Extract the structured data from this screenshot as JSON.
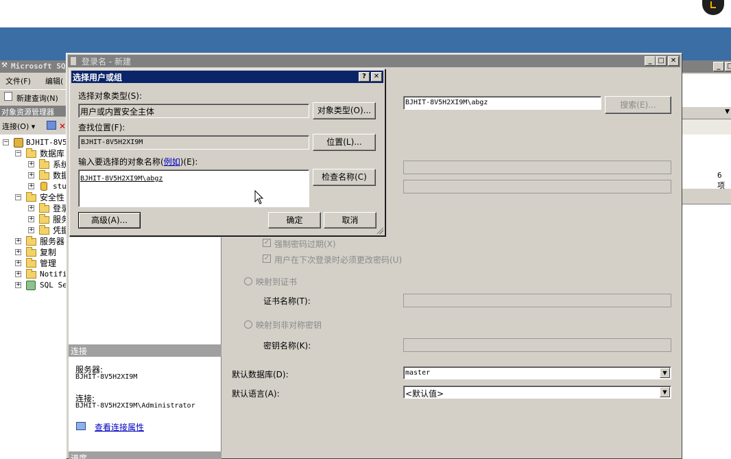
{
  "main_window": {
    "title": "Microsoft SQ",
    "menu": [
      "文件(F)",
      "编辑("
    ],
    "toolbar_new_query": "新建查询(N)",
    "explorer_title": "对象资源管理器",
    "connect_label": "连接(O) ▾",
    "right_count": "6 项"
  },
  "tree": [
    {
      "label": "BJHIT-8V5",
      "level": 0,
      "expander": "−",
      "icon": "server-icon"
    },
    {
      "label": "数据库",
      "level": 1,
      "expander": "−",
      "icon": "folder-icon"
    },
    {
      "label": "系统",
      "level": 2,
      "expander": "+",
      "icon": "folder-icon"
    },
    {
      "label": "数据",
      "level": 2,
      "expander": "+",
      "icon": "folder-icon"
    },
    {
      "label": "stu",
      "level": 2,
      "expander": "+",
      "icon": "database-icon"
    },
    {
      "label": "安全性",
      "level": 1,
      "expander": "−",
      "icon": "folder-icon"
    },
    {
      "label": "登录",
      "level": 2,
      "expander": "+",
      "icon": "folder-icon"
    },
    {
      "label": "服务",
      "level": 2,
      "expander": "+",
      "icon": "folder-icon"
    },
    {
      "label": "凭据",
      "level": 2,
      "expander": "+",
      "icon": "folder-icon"
    },
    {
      "label": "服务器",
      "level": 1,
      "expander": "+",
      "icon": "folder-icon"
    },
    {
      "label": "复制",
      "level": 1,
      "expander": "+",
      "icon": "folder-icon"
    },
    {
      "label": "管理",
      "level": 1,
      "expander": "+",
      "icon": "folder-icon"
    },
    {
      "label": "Notifi",
      "level": 1,
      "expander": "+",
      "icon": "folder-icon"
    },
    {
      "label": "SQL Se",
      "level": 1,
      "expander": "+",
      "icon": "agent-icon"
    }
  ],
  "login_dialog": {
    "title": "登录名 - 新建",
    "login_name_value": "BJHIT-8V5H2XI9M\\abgz",
    "search_button": "搜索(E)...",
    "enforce_expiration": "强制密码过期(X)",
    "must_change": "用户在下次登录时必须更改密码(U)",
    "map_cert": "映射到证书",
    "cert_name_label": "证书名称(T):",
    "map_key": "映射到非对称密钥",
    "key_name_label": "密钥名称(K):",
    "default_db_label": "默认数据库(D):",
    "default_db_value": "master",
    "default_lang_label": "默认语言(A):",
    "default_lang_value": "<默认值>",
    "connection_header": "连接",
    "server_label": "服务器:",
    "server_value": "BJHIT-8V5H2XI9M",
    "connection_label": "连接:",
    "connection_value": "BJHIT-8V5H2XI9M\\Administrator",
    "view_props_link": "查看连接属性",
    "progress_header": "进度"
  },
  "select_dialog": {
    "title": "选择用户或组",
    "help_button": "?",
    "close_button": "✕",
    "object_type_label": "选择对象类型(S):",
    "object_type_value": "用户或内置安全主体",
    "object_type_button": "对象类型(O)...",
    "location_label": "查找位置(F):",
    "location_value": "BJHIT-8V5H2XI9M",
    "location_button": "位置(L)...",
    "names_label_pre": "输入要选择的对象名称(",
    "names_label_link": "例如",
    "names_label_post": ")(E):",
    "names_value": "BJHIT-8V5H2XI9M\\abgz",
    "check_names_button": "检查名称(C)",
    "advanced_button": "高级(A)...",
    "ok_button": "确定",
    "cancel_button": "取消"
  },
  "colors": {
    "desktop_band": "#3a6ea5",
    "title_active": "#0a246a",
    "title_inactive": "#808080",
    "face": "#d4d0c8"
  }
}
